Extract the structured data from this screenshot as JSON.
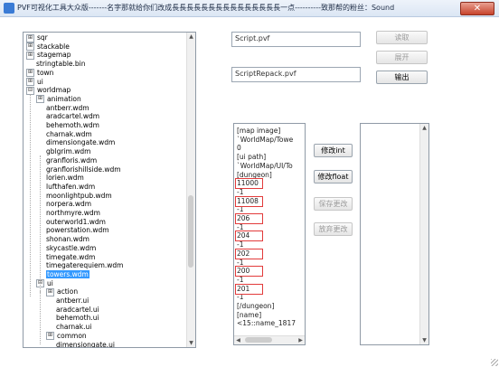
{
  "window": {
    "title": "PVF可视化工具大众版-------名字那就给你们改成長長長長長長長長長長長長長長長一点----------致那帮的粉丝：Sound",
    "close_label": "✕"
  },
  "tree": {
    "items": [
      {
        "label": "sqr",
        "expander": "⊞"
      },
      {
        "label": "stackable",
        "expander": "⊞"
      },
      {
        "label": "stagemap",
        "expander": "⊞"
      },
      {
        "label": "stringtable.bin",
        "expander": ""
      },
      {
        "label": "town",
        "expander": "⊞"
      },
      {
        "label": "ui",
        "expander": "⊞"
      },
      {
        "label": "worldmap",
        "expander": "⊟"
      },
      {
        "label": "animation",
        "expander": "⊞"
      },
      {
        "label": "antberr.wdm",
        "expander": ""
      },
      {
        "label": "aradcartel.wdm",
        "expander": ""
      },
      {
        "label": "behemoth.wdm",
        "expander": ""
      },
      {
        "label": "charnak.wdm",
        "expander": ""
      },
      {
        "label": "dimensiongate.wdm",
        "expander": ""
      },
      {
        "label": "gblgrim.wdm",
        "expander": ""
      },
      {
        "label": "granfloris.wdm",
        "expander": ""
      },
      {
        "label": "granflorishillside.wdm",
        "expander": ""
      },
      {
        "label": "lorien.wdm",
        "expander": ""
      },
      {
        "label": "lufthafen.wdm",
        "expander": ""
      },
      {
        "label": "moonlightpub.wdm",
        "expander": ""
      },
      {
        "label": "norpera.wdm",
        "expander": ""
      },
      {
        "label": "northmyre.wdm",
        "expander": ""
      },
      {
        "label": "outerworld1.wdm",
        "expander": ""
      },
      {
        "label": "powerstation.wdm",
        "expander": ""
      },
      {
        "label": "shonan.wdm",
        "expander": ""
      },
      {
        "label": "skycastle.wdm",
        "expander": ""
      },
      {
        "label": "timegate.wdm",
        "expander": ""
      },
      {
        "label": "timegaterequiem.wdm",
        "expander": ""
      },
      {
        "label": "towers.wdm",
        "expander": ""
      },
      {
        "label": "ui",
        "expander": "⊟"
      },
      {
        "label": "action",
        "expander": "⊞"
      },
      {
        "label": "antberr.ui",
        "expander": ""
      },
      {
        "label": "aradcartel.ui",
        "expander": ""
      },
      {
        "label": "behemoth.ui",
        "expander": ""
      },
      {
        "label": "charnak.ui",
        "expander": ""
      },
      {
        "label": "common",
        "expander": "⊞"
      },
      {
        "label": "dimensiongate.ui",
        "expander": ""
      }
    ],
    "selected": "towers.wdm"
  },
  "fields": {
    "script_path": "Script.pvf",
    "repack_path": "ScriptRepack.pvf"
  },
  "buttons": {
    "read": "读取",
    "expand": "展开",
    "output": "输出",
    "modify_int": "修改int",
    "modify_float": "修改float",
    "save_changes": "保存更改",
    "discard_changes": "放弃更改"
  },
  "content": {
    "lines": [
      "[map image]",
      "`WorldMap/Towe",
      "0",
      "[ui path]",
      "`WorldMap/UI/To",
      "[dungeon]",
      "11000",
      "-1",
      "11008",
      "-1",
      "206",
      "-1",
      "204",
      "-1",
      "202",
      "-1",
      "200",
      "-1",
      "201",
      "-1",
      "[/dungeon]",
      "[name]",
      "<15::name_1817"
    ]
  },
  "scroll_icons": {
    "up": "▲",
    "down": "▼",
    "left": "◀",
    "right": "▶"
  }
}
